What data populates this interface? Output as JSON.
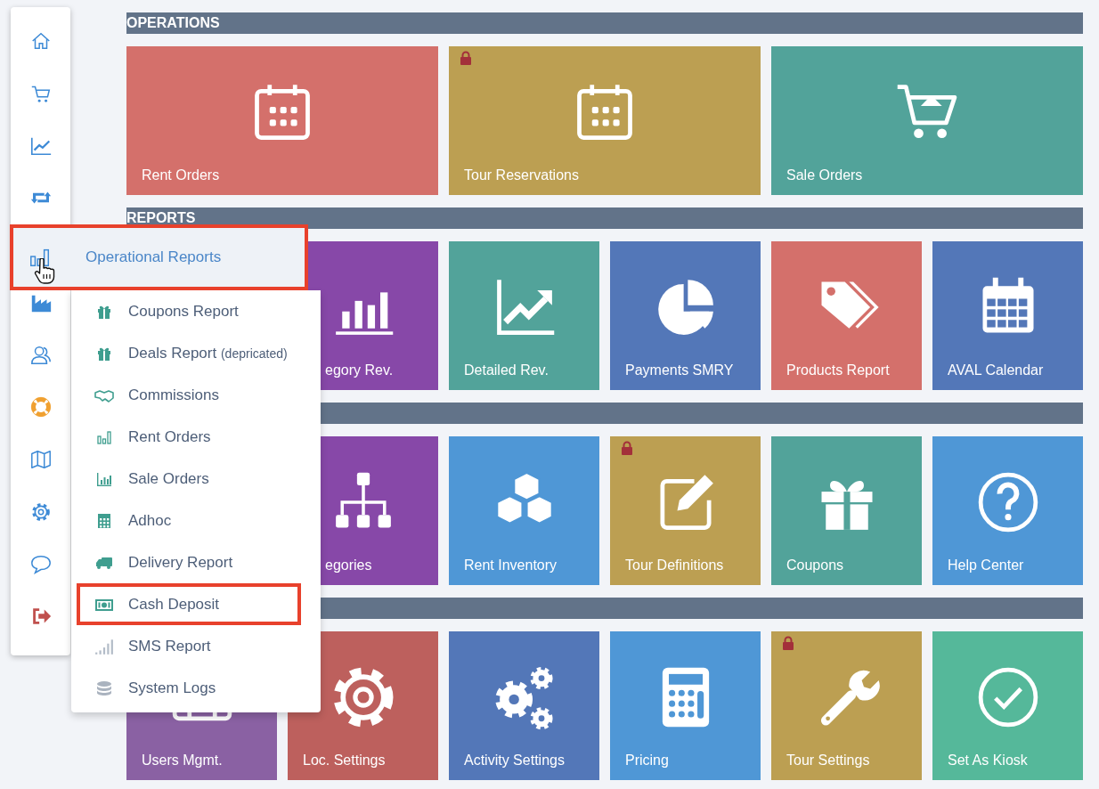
{
  "sections": [
    {
      "title": "OPERATIONS",
      "tiles": [
        {
          "label": "Rent Orders",
          "color": "#d4706b",
          "locked": false,
          "covered": false,
          "kind": "wide"
        },
        {
          "label": "Tour Reservations",
          "color": "#bc9f52",
          "locked": true,
          "covered": false,
          "kind": "wide"
        },
        {
          "label": "Sale Orders",
          "color": "#52a39a",
          "locked": false,
          "covered": false,
          "kind": "wide"
        }
      ]
    },
    {
      "title": "REPORTS",
      "tiles": [
        {
          "label": "egory Rev.",
          "color": "#8748a8",
          "locked": false,
          "covered": true,
          "kind": "small"
        },
        {
          "label": "Detailed Rev.",
          "color": "#52a39a",
          "locked": false,
          "covered": false,
          "kind": "small"
        },
        {
          "label": "Payments SMRY",
          "color": "#5377b8",
          "locked": false,
          "covered": false,
          "kind": "small"
        },
        {
          "label": "Products Report",
          "color": "#d4706b",
          "locked": false,
          "covered": false,
          "kind": "small"
        },
        {
          "label": "AVAL Calendar",
          "color": "#5377b8",
          "locked": false,
          "covered": false,
          "kind": "small"
        }
      ]
    },
    {
      "tiles": [
        {
          "label": "egories",
          "color": "#8748a8",
          "locked": false,
          "covered": true,
          "kind": "small"
        },
        {
          "label": "Rent Inventory",
          "color": "#4f97d6",
          "locked": false,
          "covered": false,
          "kind": "small"
        },
        {
          "label": "Tour Definitions",
          "color": "#bc9f52",
          "locked": true,
          "covered": false,
          "kind": "small"
        },
        {
          "label": "Coupons",
          "color": "#52a39a",
          "locked": false,
          "covered": false,
          "kind": "small"
        },
        {
          "label": "Help Center",
          "color": "#4f97d6",
          "locked": false,
          "covered": false,
          "kind": "small"
        }
      ]
    },
    {
      "tiles": [
        {
          "label": "Users Mgmt.",
          "color": "#8a61a3",
          "covered": false,
          "kind": "small"
        },
        {
          "label": "Loc. Settings",
          "color": "#bd605d",
          "covered": false,
          "kind": "small"
        },
        {
          "label": "Activity Settings",
          "color": "#5377b8",
          "locked": false,
          "covered": false,
          "kind": "small"
        },
        {
          "label": "Pricing",
          "color": "#4f97d6",
          "locked": false,
          "covered": false,
          "kind": "small"
        },
        {
          "label": "Tour Settings",
          "color": "#bc9f52",
          "locked": true,
          "covered": false,
          "kind": "small"
        },
        {
          "label": "Set As Kiosk",
          "color": "#55b89a",
          "locked": false,
          "covered": false,
          "kind": "small"
        }
      ]
    }
  ],
  "menu": {
    "title": "Operational Reports",
    "highlighted": true,
    "items": [
      {
        "label": "Coupons Report",
        "highlighted": false
      },
      {
        "label": "Deals Report",
        "note": "(depricated)",
        "highlighted": false
      },
      {
        "label": "Commissions",
        "highlighted": false
      },
      {
        "label": "Rent Orders",
        "highlighted": false
      },
      {
        "label": "Sale Orders",
        "highlighted": false
      },
      {
        "label": "Adhoc",
        "highlighted": false
      },
      {
        "label": "Delivery Report",
        "highlighted": false
      },
      {
        "label": "Cash Deposit",
        "highlighted": true
      },
      {
        "label": "SMS Report",
        "highlighted": false
      },
      {
        "label": "System Logs",
        "highlighted": false
      }
    ]
  }
}
